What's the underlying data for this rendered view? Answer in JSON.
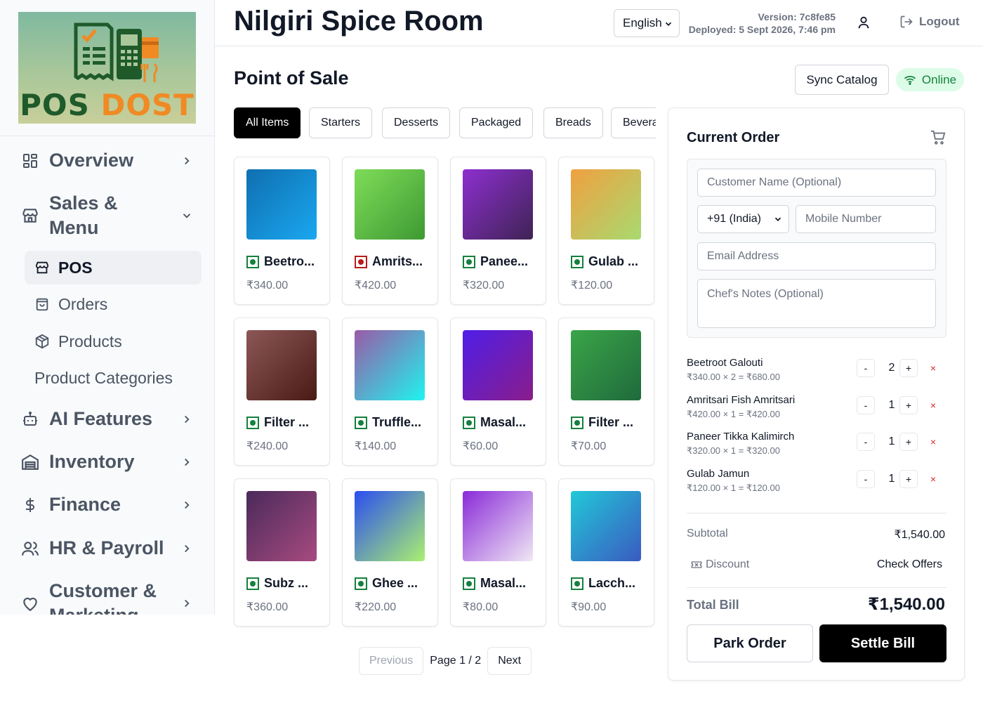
{
  "brand": {
    "logo_text_pos": "POS",
    "logo_text_dost": "DOST"
  },
  "sidebar": {
    "items": [
      {
        "label": "Overview",
        "icon": "grid-icon"
      },
      {
        "label": "Sales &\nMenu",
        "icon": "store-icon"
      },
      {
        "label": "AI Features",
        "icon": "robot-icon"
      },
      {
        "label": "Inventory",
        "icon": "warehouse-icon"
      },
      {
        "label": "Finance",
        "icon": "dollar-icon"
      },
      {
        "label": "HR & Payroll",
        "icon": "users-icon"
      },
      {
        "label": "Customer &\nMarketing",
        "icon": "heart-icon"
      }
    ],
    "sub_items": [
      {
        "label": "POS",
        "icon": "store-icon"
      },
      {
        "label": "Orders",
        "icon": "bag-icon"
      },
      {
        "label": "Products",
        "icon": "box-icon"
      },
      {
        "label": "Product Categories"
      }
    ]
  },
  "header": {
    "title": "Nilgiri Spice Room",
    "language": "English",
    "version_line": "Version: 7c8fe85",
    "deployed_line": "Deployed: 5 Sept 2026, 7:46 pm",
    "logout_label": "Logout"
  },
  "main": {
    "page_title": "Point of Sale",
    "sync_label": "Sync Catalog",
    "status_label": "Online",
    "tabs": [
      "All Items",
      "Starters",
      "Desserts",
      "Packaged",
      "Breads",
      "Beverages"
    ],
    "products": [
      {
        "name": "Beetro...",
        "price": "₹340.00",
        "type": "veg",
        "grad": [
          "#0f6fb0",
          "#1aa7f0"
        ]
      },
      {
        "name": "Amrits...",
        "price": "₹420.00",
        "type": "nonveg",
        "grad": [
          "#7fdc58",
          "#3e9a32"
        ]
      },
      {
        "name": "Panee...",
        "price": "₹320.00",
        "type": "veg",
        "grad": [
          "#8d2fd0",
          "#3f2354"
        ]
      },
      {
        "name": "Gulab ...",
        "price": "₹120.00",
        "type": "veg",
        "grad": [
          "#f0a040",
          "#a8da70"
        ]
      },
      {
        "name": "Filter ...",
        "price": "₹240.00",
        "type": "veg",
        "grad": [
          "#8b5757",
          "#4a1a14"
        ]
      },
      {
        "name": "Truffle...",
        "price": "₹140.00",
        "type": "veg",
        "grad": [
          "#9a5aa8",
          "#1ef4ee"
        ]
      },
      {
        "name": "Masal...",
        "price": "₹60.00",
        "type": "veg",
        "grad": [
          "#4f1ee8",
          "#8a1d8a"
        ]
      },
      {
        "name": "Filter ...",
        "price": "₹70.00",
        "type": "veg",
        "grad": [
          "#3aa548",
          "#1f6a3c"
        ]
      },
      {
        "name": "Subz ...",
        "price": "₹360.00",
        "type": "veg",
        "grad": [
          "#4a2a5a",
          "#a84a80"
        ]
      },
      {
        "name": "Ghee ...",
        "price": "₹220.00",
        "type": "veg",
        "grad": [
          "#2a4ef0",
          "#aaf070"
        ]
      },
      {
        "name": "Masal...",
        "price": "₹80.00",
        "type": "veg",
        "grad": [
          "#8a2ad8",
          "#f0e8f4"
        ]
      },
      {
        "name": "Lacch...",
        "price": "₹90.00",
        "type": "veg",
        "grad": [
          "#22c8d8",
          "#3a5ac0"
        ]
      }
    ],
    "pager": {
      "prev": "Previous",
      "info": "Page 1 / 2",
      "next": "Next"
    }
  },
  "order": {
    "title": "Current Order",
    "customer_name_placeholder": "Customer Name (Optional)",
    "country_code": "+91 (India)",
    "mobile_placeholder": "Mobile Number",
    "email_placeholder": "Email Address",
    "notes_placeholder": "Chef's Notes (Optional)",
    "items": [
      {
        "name": "Beetroot Galouti",
        "calc": "₹340.00 × 2 = ₹680.00",
        "qty": "2"
      },
      {
        "name": "Amritsari Fish Amritsari",
        "calc": "₹420.00 × 1 = ₹420.00",
        "qty": "1"
      },
      {
        "name": "Paneer Tikka Kalimirch",
        "calc": "₹320.00 × 1 = ₹320.00",
        "qty": "1"
      },
      {
        "name": "Gulab Jamun",
        "calc": "₹120.00 × 1 = ₹120.00",
        "qty": "1"
      }
    ],
    "minus": "-",
    "plus": "+",
    "remove": "×",
    "subtotal_label": "Subtotal",
    "subtotal_value": "₹1,540.00",
    "discount_label": "Discount",
    "check_offers": "Check Offers",
    "total_label": "Total Bill",
    "total_value": "₹1,540.00",
    "park_label": "Park Order",
    "settle_label": "Settle Bill"
  }
}
